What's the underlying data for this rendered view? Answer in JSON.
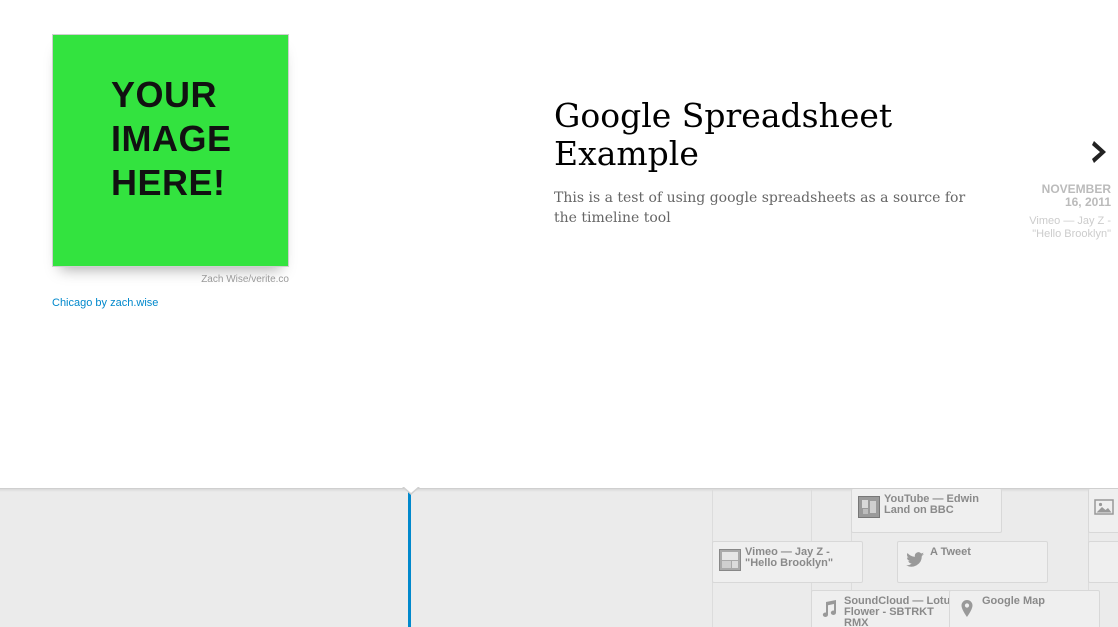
{
  "slide": {
    "media_text": [
      "YOUR",
      "IMAGE",
      "HERE!"
    ],
    "media_credit": "Zach Wise/verite.co",
    "media_caption": "Chicago by zach.wise",
    "headline": "Google Spreadsheet Example",
    "text": "This is a test of using google spreadsheets as a source for the timeline tool",
    "media_bg": "#33e33f"
  },
  "next": {
    "icon": "chevron-right-icon",
    "date_line1": "NOVEMBER",
    "date_line2": "16, 2011",
    "title_line1": "Vimeo — Jay Z -",
    "title_line2": "\"Hello Brooklyn\""
  },
  "timeline": {
    "accent": "#0088cc",
    "markers": [
      {
        "label": "YouTube — Edwin Land on BBC",
        "icon": "video-thumbnail-icon"
      },
      {
        "label": "Vimeo — Jay Z - \"Hello Brooklyn\"",
        "icon": "vimeo-thumbnail-icon"
      },
      {
        "label": "A Tweet",
        "icon": "twitter-icon"
      },
      {
        "label": "SoundCloud — Lotus Flower - SBTRKT RMX",
        "icon": "music-note-icon"
      },
      {
        "label": "Google Map",
        "icon": "map-pin-icon"
      },
      {
        "label": "",
        "icon": "image-icon"
      }
    ]
  }
}
